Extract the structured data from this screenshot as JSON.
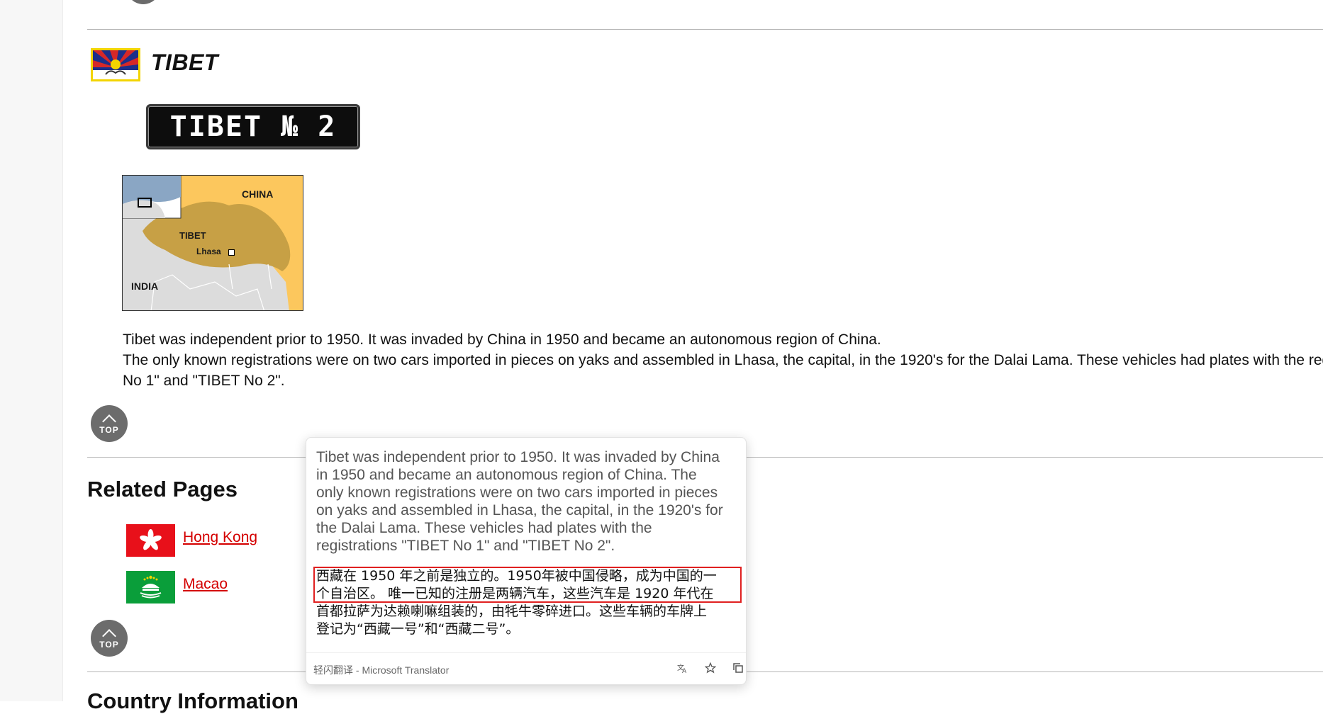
{
  "section": {
    "title": "TIBET",
    "plate_text": "TIBET № 2",
    "map_labels": {
      "china": "CHINA",
      "tibet": "TIBET",
      "lhasa": "Lhasa",
      "india": "INDIA"
    },
    "paragraph_lines": [
      "Tibet was independent prior to 1950. It was invaded by China in 1950 and became an autonomous region of China.",
      "The only known registrations were on two cars imported in pieces on yaks and assembled in Lhasa, the capital, in the 1920's for the Dalai Lama. These vehicles had plates with the regis",
      "No 1\" and \"TIBET No 2\"."
    ]
  },
  "top_button": {
    "label": "TOP"
  },
  "related": {
    "title": "Related Pages",
    "links": [
      {
        "label": "Hong Kong",
        "flag": "hong-kong-flag"
      },
      {
        "label": "Macao",
        "flag": "macao-flag"
      }
    ]
  },
  "translator_popup": {
    "source_lines": [
      "Tibet was independent prior to 1950. It was invaded by China",
      "in 1950 and became an autonomous region of China. The",
      "only known registrations were on two cars imported in pieces",
      "on yaks and assembled in Lhasa, the capital, in the 1920's for",
      "the Dalai Lama. These vehicles had plates with the",
      "registrations \"TIBET No 1\" and \"TIBET No 2\"."
    ],
    "translation_lines": [
      "西藏在 1950 年之前是独立的。1950年被中国侵略，成为中国的一",
      "个自治区。 唯一已知的注册是两辆汽车，这些汽车是 1920 年代在",
      "首都拉萨为达赖喇嘛组装的，由牦牛零碎进口。这些车辆的车牌上",
      "登记为“西藏一号”和“西藏二号”。"
    ],
    "credit": "轻闪翻译 - Microsoft Translator",
    "icons": [
      "translate-icon",
      "star-icon",
      "copy-icon"
    ]
  },
  "next_section_title": "Country Information",
  "colors": {
    "link": "#d40000",
    "top_button": "#6c6c6c",
    "highlight": "#e02020"
  }
}
